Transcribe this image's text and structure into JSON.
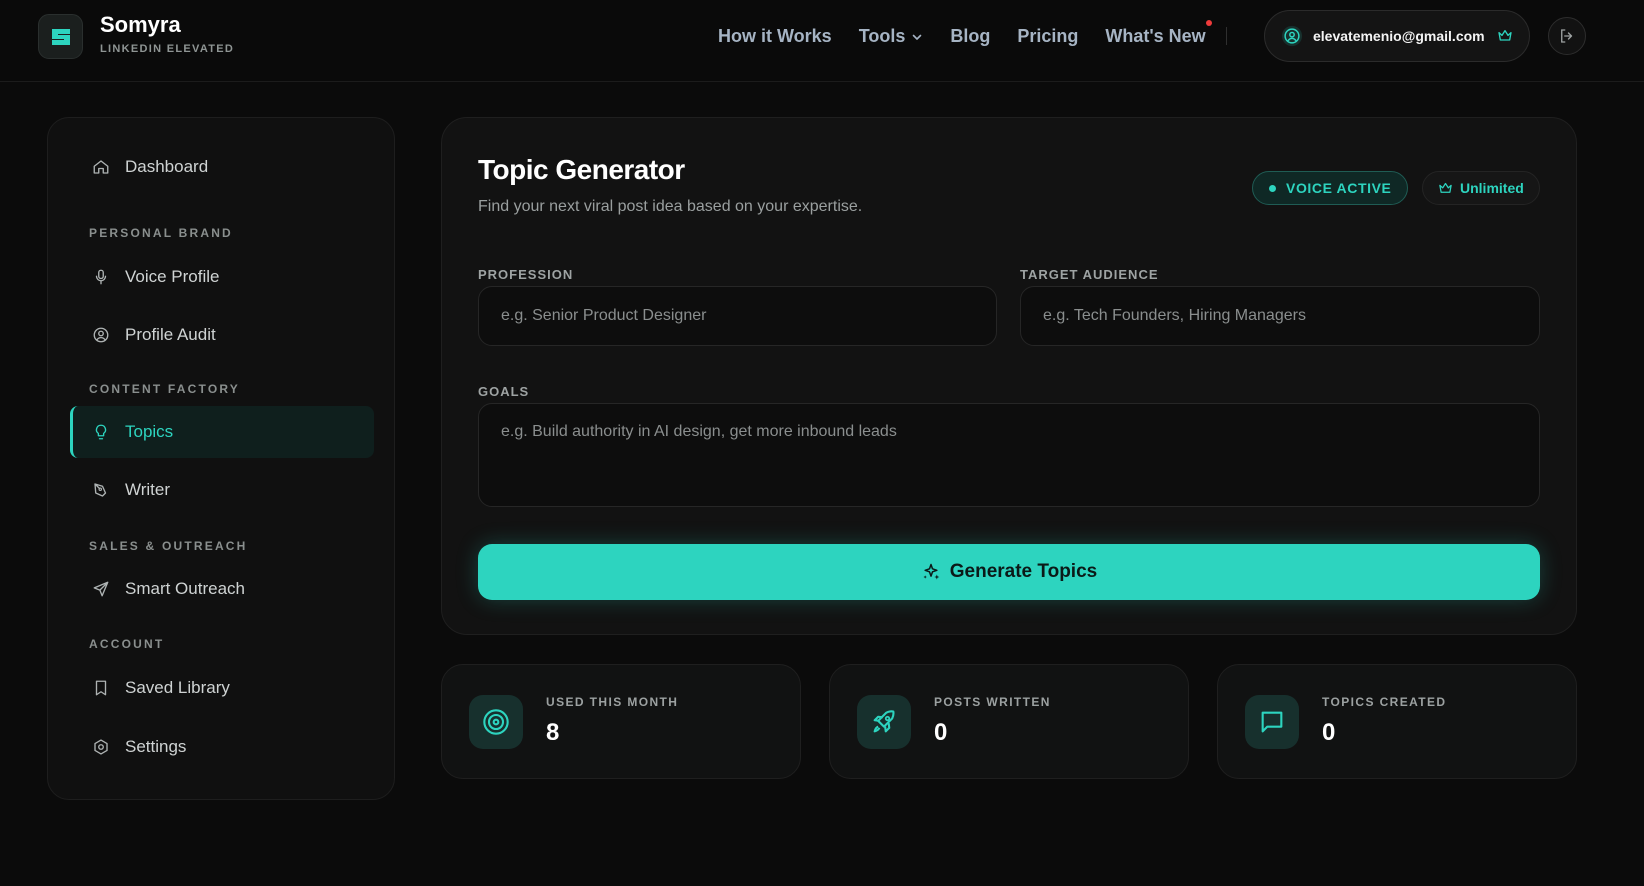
{
  "brand": {
    "name": "Somyra",
    "tagline": "LINKEDIN ELEVATED"
  },
  "nav": {
    "items": [
      {
        "label": "How it Works"
      },
      {
        "label": "Tools"
      },
      {
        "label": "Blog"
      },
      {
        "label": "Pricing"
      },
      {
        "label": "What's New"
      }
    ]
  },
  "user": {
    "email": "elevatemenio@gmail.com"
  },
  "sidebar": {
    "dashboard": "Dashboard",
    "sections": {
      "personal_brand": "PERSONAL BRAND",
      "content_factory": "CONTENT FACTORY",
      "sales_outreach": "SALES & OUTREACH",
      "account": "ACCOUNT"
    },
    "items": {
      "voice_profile": "Voice Profile",
      "profile_audit": "Profile Audit",
      "topics": "Topics",
      "writer": "Writer",
      "smart_outreach": "Smart Outreach",
      "saved_library": "Saved Library",
      "settings": "Settings"
    }
  },
  "main": {
    "title": "Topic Generator",
    "subtitle": "Find your next viral post idea based on your expertise.",
    "voice_badge": "VOICE ACTIVE",
    "plan_badge": "Unlimited",
    "profession": {
      "label": "PROFESSION",
      "placeholder": "e.g. Senior Product Designer",
      "value": ""
    },
    "audience": {
      "label": "TARGET AUDIENCE",
      "placeholder": "e.g. Tech Founders, Hiring Managers",
      "value": ""
    },
    "goals": {
      "label": "GOALS",
      "placeholder": "e.g. Build authority in AI design, get more inbound leads",
      "value": ""
    },
    "generate_label": "Generate Topics"
  },
  "stats": [
    {
      "label": "USED THIS MONTH",
      "value": "8",
      "icon": "target-icon"
    },
    {
      "label": "POSTS WRITTEN",
      "value": "0",
      "icon": "rocket-icon"
    },
    {
      "label": "TOPICS CREATED",
      "value": "0",
      "icon": "message-square-icon"
    }
  ],
  "colors": {
    "accent": "#2dd4bf",
    "background": "#0b0b0b",
    "notification": "#ef3b3b"
  }
}
